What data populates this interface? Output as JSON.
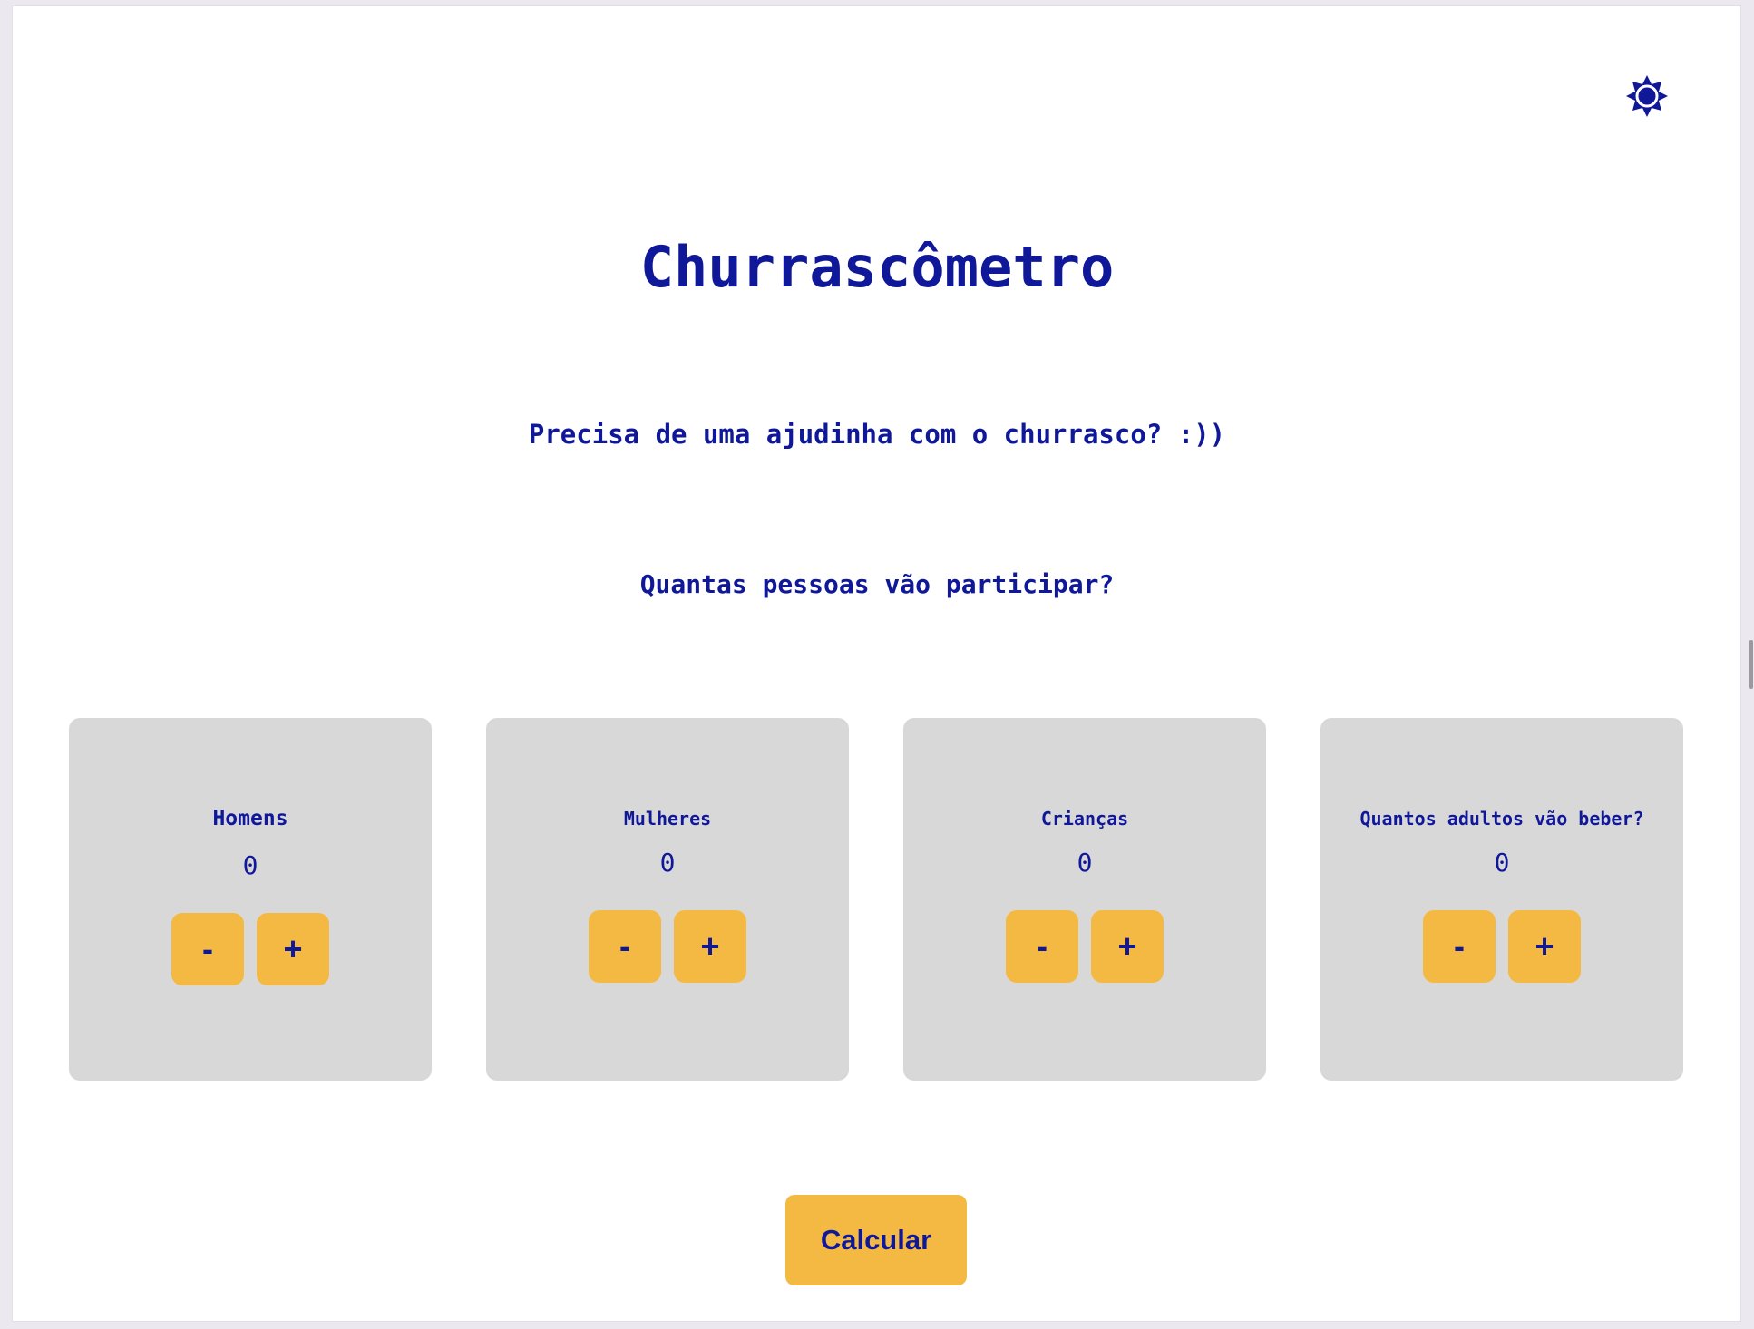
{
  "app": {
    "title": "Churrascômetro",
    "subtitle": "Precisa de uma ajudinha com o churrasco? :))",
    "question": "Quantas pessoas vão participar?"
  },
  "header": {
    "theme_icon": "sun-icon"
  },
  "counters": [
    {
      "label": "Homens",
      "value": "0",
      "minus": "-",
      "plus": "+"
    },
    {
      "label": "Mulheres",
      "value": "0",
      "minus": "-",
      "plus": "+"
    },
    {
      "label": "Crianças",
      "value": "0",
      "minus": "-",
      "plus": "+"
    },
    {
      "label": "Quantos adultos vão beber?",
      "value": "0",
      "minus": "-",
      "plus": "+"
    }
  ],
  "actions": {
    "calculate_label": "Calcular"
  },
  "colors": {
    "primary_text": "#10189a",
    "accent": "#f4b942",
    "card_bg": "#d9d8d8",
    "page_bg": "#ffffff"
  }
}
